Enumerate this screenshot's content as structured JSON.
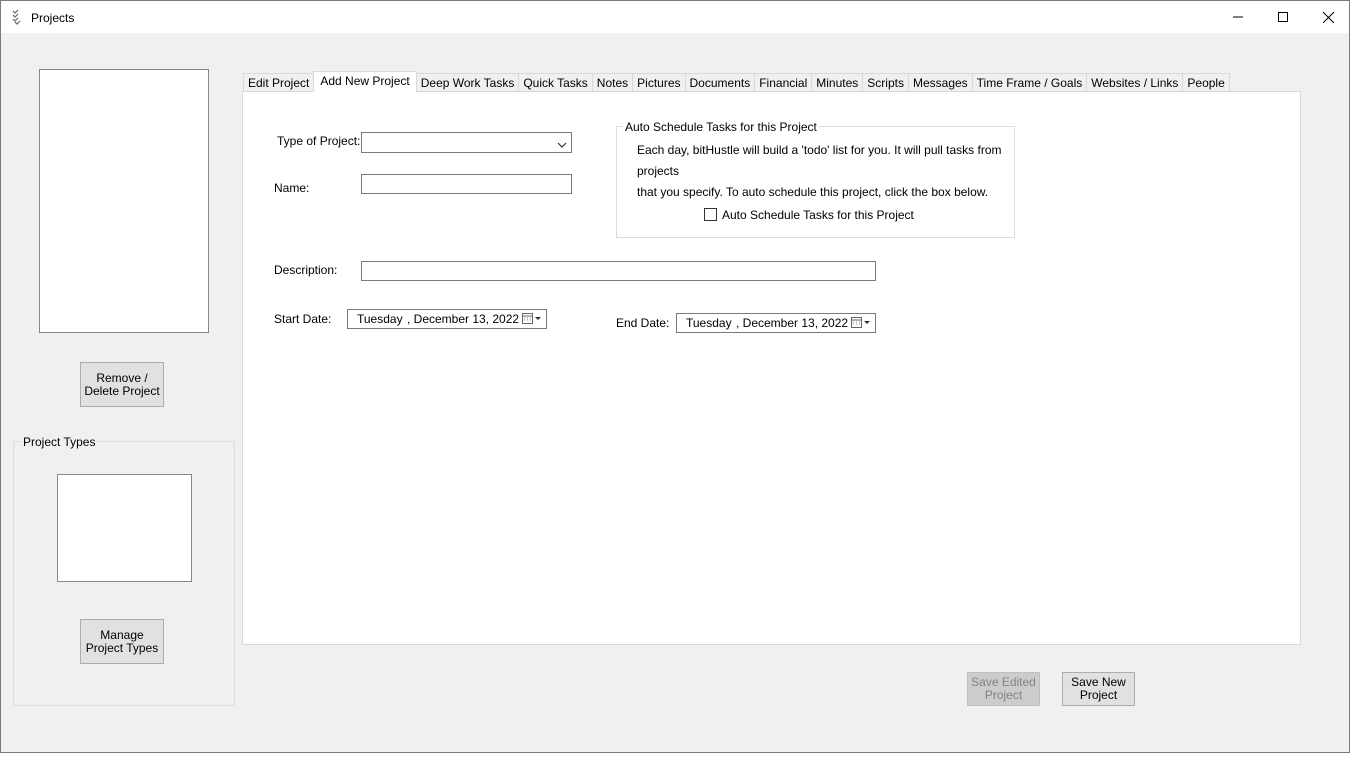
{
  "window": {
    "title": "Projects",
    "controls": {
      "minimize": "minimize-icon",
      "maximize": "maximize-icon",
      "close": "close-icon"
    }
  },
  "left_panel": {
    "remove_button": "Remove /\nDelete Project",
    "project_types_group": "Project Types",
    "manage_button": "Manage\nProject Types"
  },
  "tabs": [
    {
      "label": "Edit Project"
    },
    {
      "label": "Add New Project",
      "active": true
    },
    {
      "label": "Deep Work Tasks"
    },
    {
      "label": "Quick Tasks"
    },
    {
      "label": "Notes"
    },
    {
      "label": "Pictures"
    },
    {
      "label": "Documents"
    },
    {
      "label": "Financial"
    },
    {
      "label": "Minutes"
    },
    {
      "label": "Scripts"
    },
    {
      "label": "Messages"
    },
    {
      "label": "Time Frame / Goals"
    },
    {
      "label": "Websites / Links"
    },
    {
      "label": "People"
    }
  ],
  "form": {
    "type_label": "Type of Project:",
    "type_value": "",
    "name_label": "Name:",
    "name_value": "",
    "description_label": "Description:",
    "description_value": "",
    "start_label": "Start Date:",
    "start_day": "Tuesday",
    "start_date": ", December 13, 2022",
    "end_label": "End Date:",
    "end_day": "Tuesday",
    "end_date": ", December 13, 2022"
  },
  "auto_schedule": {
    "group_label": "Auto Schedule Tasks for this Project",
    "line1": "Each day, bitHustle will build a 'todo' list for you.  It will pull tasks from projects",
    "line2": "that you specify.  To auto schedule this project, click the box below.",
    "checkbox_label": "Auto Schedule Tasks for this Project",
    "checked": false
  },
  "bottom": {
    "save_edited": "Save Edited\nProject",
    "save_new": "Save New\nProject"
  },
  "colors": {
    "window_bg": "#f0f0f0",
    "panel_bg": "#ffffff",
    "button_bg": "#e1e1e1",
    "disabled_text": "#838383"
  }
}
